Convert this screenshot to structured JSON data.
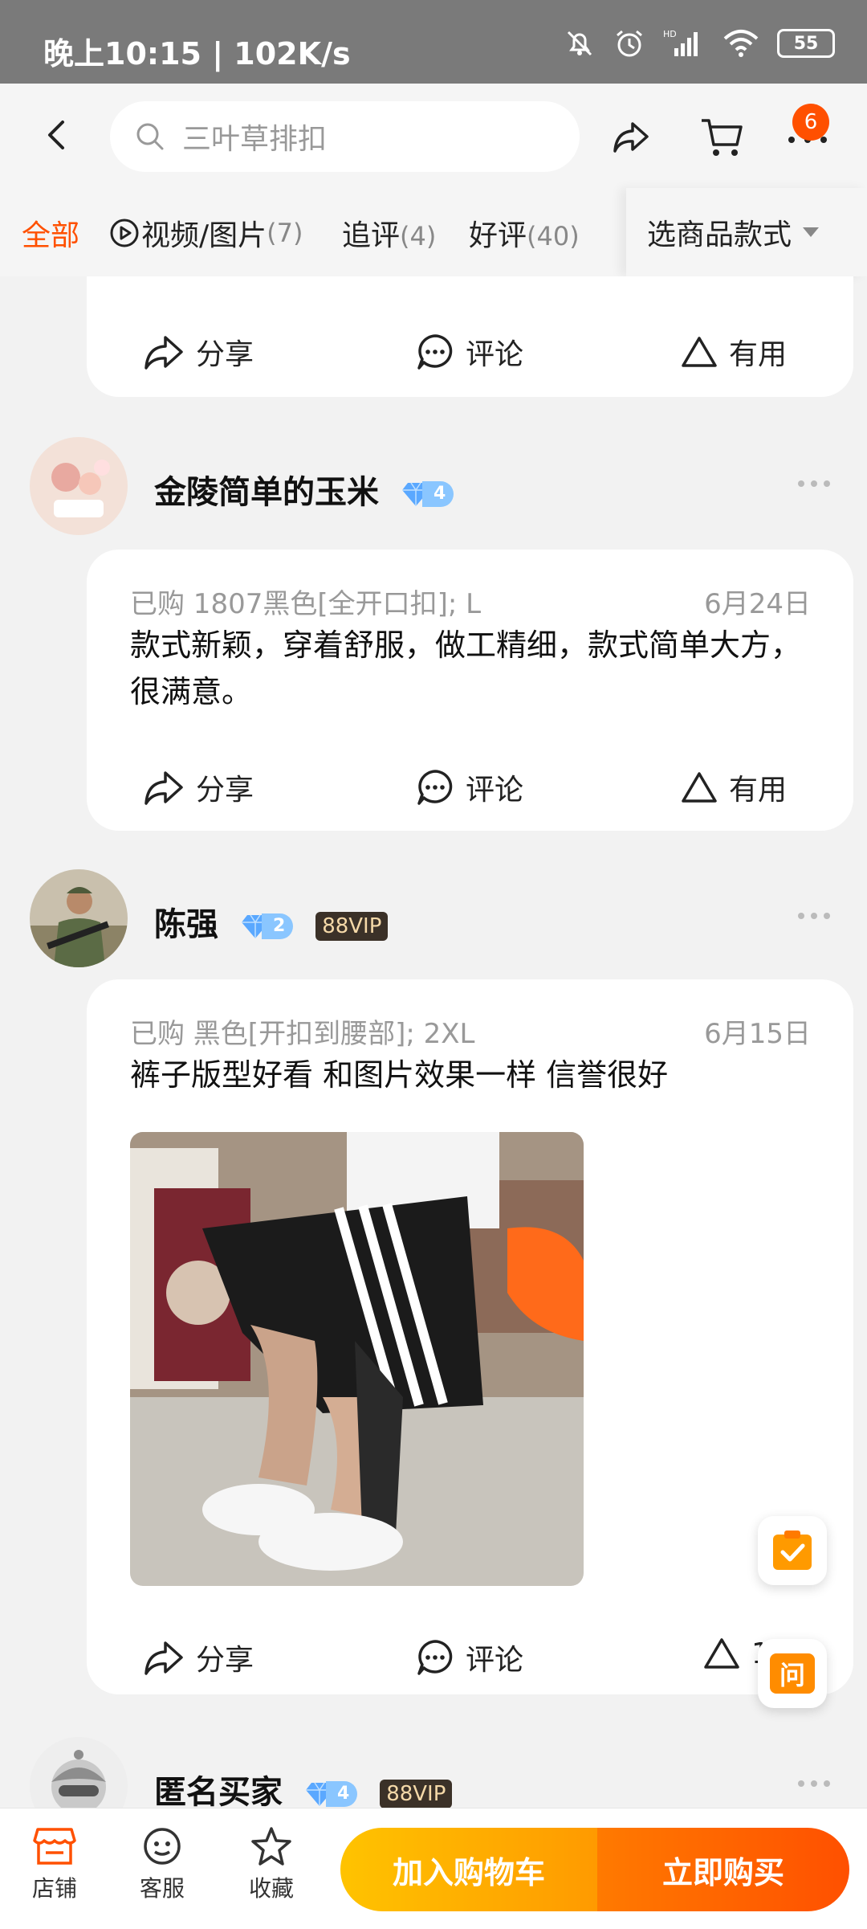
{
  "status_bar": {
    "time": "晚上10:15 | 102K/s",
    "battery": "55",
    "icons": [
      "bell-off-icon",
      "alarm-icon",
      "signal-hd-icon",
      "wifi-icon",
      "battery-icon"
    ]
  },
  "top_bar": {
    "search_placeholder": "三叶草排扣",
    "cart_badge": "6"
  },
  "filter_tabs": [
    {
      "label": "全部",
      "count": ""
    },
    {
      "label": "视频/图片",
      "count": "(7)"
    },
    {
      "label": "追评",
      "count": "(4)"
    },
    {
      "label": "好评",
      "count": "(40)"
    }
  ],
  "filter_select": "选商品款式",
  "actions": {
    "share": "分享",
    "comment": "评论",
    "useful": "有用"
  },
  "reviews": [
    {
      "user": "金陵简单的玉米",
      "level": "4",
      "purchased": "已购 1807黑色[全开口扣]; L",
      "date": "6月24日",
      "text": "款式新颖，穿着舒服，做工精细，款式简单大方，很满意。"
    },
    {
      "user": "陈强",
      "level": "2",
      "vip": "88VIP",
      "purchased": "已购 黑色[开扣到腰部]; 2XL",
      "date": "6月15日",
      "text": "裤子版型好看 和图片效果一样 信誉很好",
      "useful_count": "1"
    },
    {
      "user": "匿名买家",
      "level": "4",
      "vip": "88VIP"
    }
  ],
  "floating": {
    "ask": "问"
  },
  "bottom_bar": {
    "shop": "店铺",
    "service": "客服",
    "favorite": "收藏",
    "add_to_cart": "加入购物车",
    "buy_now": "立即购买"
  },
  "colors": {
    "accent": "#ff5000",
    "cart_button": "#ffb300",
    "diamond": "#6fb6ff",
    "vip_bg": "#3b3128"
  }
}
